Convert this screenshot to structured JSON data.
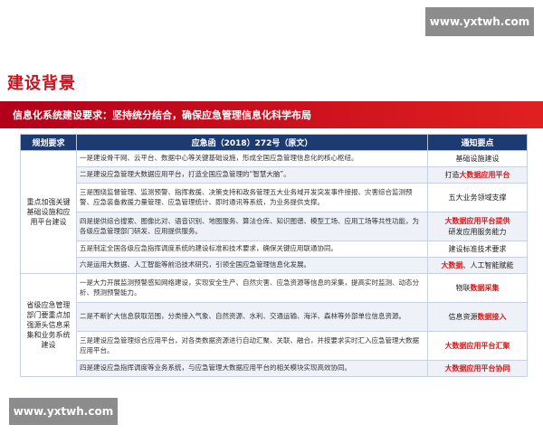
{
  "watermark": "www.yxtwh.com",
  "title": "建设背景",
  "banner": "信息化系统建设要求：坚持统分结合，确保应急管理信息化科学布局",
  "table": {
    "headers": [
      "规划要求",
      "应急函（2018）272号（原文）",
      "通知要点"
    ],
    "groups": [
      "重点加强关键基础设施和应用平台建设",
      "省级应急管理部门要重点加强源头信息采集和业务系统建设"
    ],
    "rows": [
      {
        "text": "一是建设骨干网、云平台、数据中心等关键基础设施，形成全国应急管理信息化的核心枢纽。",
        "n1": "基础设施建设",
        "r": "",
        "n2": ""
      },
      {
        "text": "二是建设应急管理大数据应用平台，打造全国应急管理的“智慧大脑”。",
        "n1": "打造",
        "r": "大数据应用平台",
        "n2": ""
      },
      {
        "text": "三是围绕监督管理、监测预警、指挥救援、决策支持和政务管理五大业务域开发突发事件接报、灾害综合监测预警、应急装备救援力量管理、应急管理统计、即时通讯等系统，为业务提供支撑。",
        "n1": "五大业务领域支撑",
        "r": "",
        "n2": ""
      },
      {
        "text": "四是提供综合搜索、图像比对、语音识别、地图服务、算法仓库、知识图谱、模型工场、应用工场等共性功能，为各级应急管理部门研发、应用提供服务。",
        "n1": "",
        "r": "大数据应用平台提供",
        "n2": "研发应用服务能力"
      },
      {
        "text": "五是制定全国各级应急指挥调度系统的建设标准和技术要求，确保关键应用联通协同。",
        "n1": "建设标准技术要求",
        "r": "",
        "n2": ""
      },
      {
        "text": "六是运用大数据、人工智能等前沿技术研究，引领全国应急管理信息化发展。",
        "n1": "",
        "r": "大数据",
        "n2": "、人工智能赋能"
      },
      {
        "text": "一是大力开展监测预警感知网络建设，实现安全生产、自然灾害、应急资源等信息的采集，提高实时监测、动态分析、预测预警能力。",
        "n1": "物联",
        "r": "数据采集",
        "n2": ""
      },
      {
        "text": "二是不断扩大信息获取范围，分类接入气象、自然资源、水利、交通运输、海洋、森林等外部单位信息资源。",
        "n1": "信息资源",
        "r": "数据接入",
        "n2": ""
      },
      {
        "text": "三是建设应急管理综合应用平台，对各类数据资源进行自动汇聚、关联、融合，并按要求实时汇入应急管理大数据应用平台。",
        "n1": "",
        "r": "大数据应用平台汇聚",
        "n2": ""
      },
      {
        "text": "四是建设应急指挥调度等业务系统，与应急管理大数据应用平台的相关模块实现高效协同。",
        "n1": "",
        "r": "大数据应用平台协同",
        "n2": ""
      }
    ]
  }
}
